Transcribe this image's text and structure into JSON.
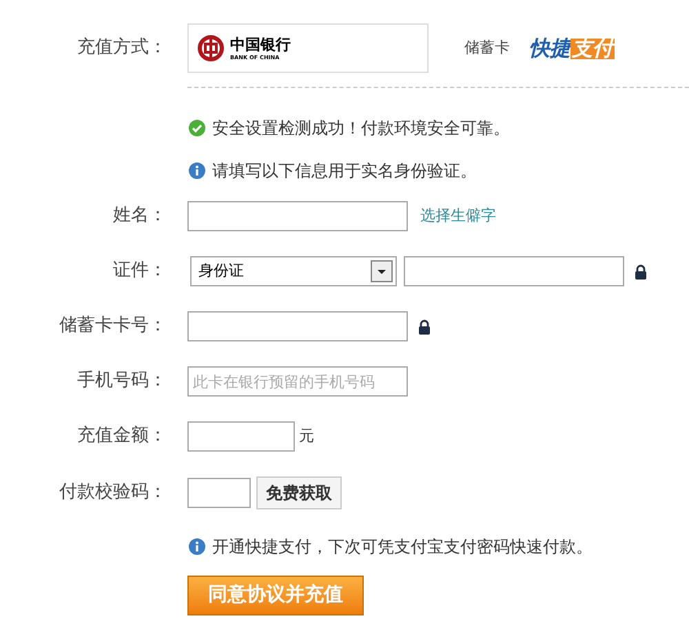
{
  "payment_method": {
    "label": "充值方式：",
    "bank_name": "中国银行",
    "bank_name_en": "BANK OF CHINA",
    "card_type": "储蓄卡",
    "quick_pay_logo": [
      "快捷",
      "支付"
    ]
  },
  "notices": [
    {
      "kind": "success",
      "text": "安全设置检测成功！付款环境安全可靠。"
    },
    {
      "kind": "info",
      "text": "请填写以下信息用于实名身份验证。"
    }
  ],
  "fields": [
    {
      "kind": "text",
      "label": "姓名：",
      "link": "选择生僻字"
    },
    {
      "kind": "id",
      "label": "证件：",
      "select": "身份证",
      "locked": true
    },
    {
      "kind": "text",
      "label": "储蓄卡卡号：",
      "locked": true
    },
    {
      "kind": "text",
      "label": "手机号码：",
      "placeholder": "此卡在银行预留的手机号码"
    },
    {
      "kind": "amount",
      "label": "充值金额：",
      "unit": "元"
    },
    {
      "kind": "code",
      "label": "付款校验码：",
      "button": "免费获取"
    }
  ],
  "footer_notice": {
    "kind": "info",
    "text": "开通快捷支付，下次可凭支付宝支付密码快速付款。"
  },
  "submit_button": "同意协议并充值"
}
